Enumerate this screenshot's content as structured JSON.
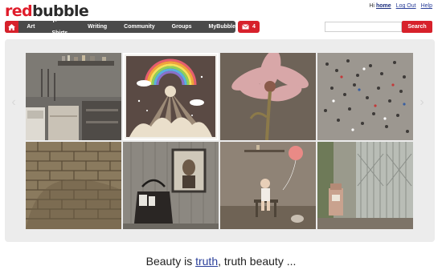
{
  "brand": {
    "part1": "red",
    "part2": "bubble"
  },
  "user": {
    "greeting": "Hi",
    "name": "home",
    "logout": "Log Out",
    "help": "Help"
  },
  "nav": {
    "home_icon": "home-icon",
    "items": [
      "Art",
      "T-Shirts",
      "Writing",
      "Community",
      "Groups",
      "MyBubble"
    ]
  },
  "messages": {
    "icon": "envelope-icon",
    "count": "4"
  },
  "search": {
    "value": "",
    "button": "Search"
  },
  "gallery": {
    "tiles": [
      {
        "name": "Abandoned kitchen"
      },
      {
        "name": "Rainbow illustration",
        "selected": true
      },
      {
        "name": "Pink flower"
      },
      {
        "name": "Crowd from above"
      },
      {
        "name": "Stone wall"
      },
      {
        "name": "Handbag and portrait"
      },
      {
        "name": "Girl with balloon"
      },
      {
        "name": "Gas pump and doors"
      }
    ]
  },
  "caption": {
    "before": "Beauty is ",
    "link": "truth",
    "after": ", truth beauty ..."
  },
  "colors": {
    "accent": "#d7212b",
    "nav": "#4a4a4a",
    "link": "#2a3f9a"
  }
}
